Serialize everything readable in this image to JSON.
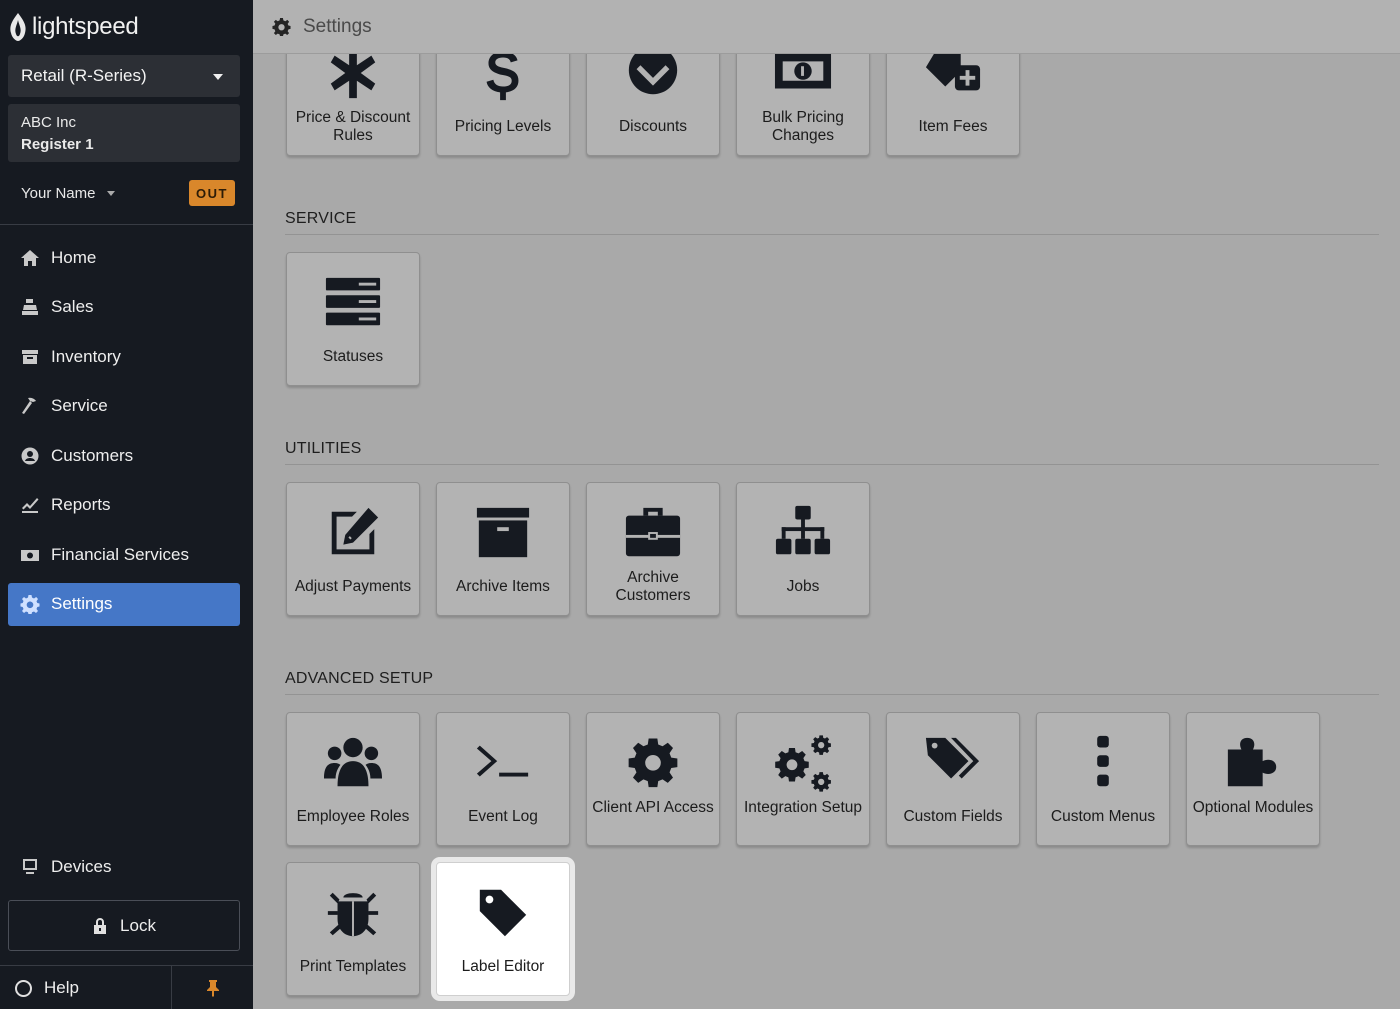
{
  "brand": {
    "name": "lightspeed"
  },
  "sidebar": {
    "account_selector": "Retail (R-Series)",
    "shop_name": "ABC Inc",
    "register": "Register 1",
    "user_name": "Your Name",
    "out_badge": "OUT",
    "nav": [
      {
        "label": "Home",
        "icon": "home-icon"
      },
      {
        "label": "Sales",
        "icon": "register-icon"
      },
      {
        "label": "Inventory",
        "icon": "inventory-icon"
      },
      {
        "label": "Service",
        "icon": "hammer-icon"
      },
      {
        "label": "Customers",
        "icon": "customer-icon"
      },
      {
        "label": "Reports",
        "icon": "chart-icon"
      },
      {
        "label": "Financial Services",
        "icon": "money-icon"
      },
      {
        "label": "Settings",
        "icon": "gear-icon",
        "active": true
      }
    ],
    "devices": "Devices",
    "lock": "Lock",
    "help": "Help"
  },
  "header": {
    "title": "Settings"
  },
  "sections": {
    "pricing_tiles": [
      {
        "label": "Price & Discount Rules",
        "icon": "asterisk-icon"
      },
      {
        "label": "Pricing Levels",
        "icon": "dollar-icon"
      },
      {
        "label": "Discounts",
        "icon": "chevron-circle-icon"
      },
      {
        "label": "Bulk Pricing Changes",
        "icon": "money-bill-icon"
      },
      {
        "label": "Item Fees",
        "icon": "tag-plus-icon"
      }
    ],
    "service": {
      "title": "SERVICE",
      "tiles": [
        {
          "label": "Statuses",
          "icon": "server-icon"
        }
      ]
    },
    "utilities": {
      "title": "UTILITIES",
      "tiles": [
        {
          "label": "Adjust Payments",
          "icon": "edit-icon"
        },
        {
          "label": "Archive Items",
          "icon": "archive-icon"
        },
        {
          "label": "Archive Customers",
          "icon": "briefcase-icon"
        },
        {
          "label": "Jobs",
          "icon": "sitemap-icon"
        }
      ]
    },
    "advanced": {
      "title": "ADVANCED SETUP",
      "tiles": [
        {
          "label": "Employee Roles",
          "icon": "users-icon"
        },
        {
          "label": "Event Log",
          "icon": "terminal-icon"
        },
        {
          "label": "Client API Access",
          "icon": "gear-icon"
        },
        {
          "label": "Integration Setup",
          "icon": "gears-icon"
        },
        {
          "label": "Custom Fields",
          "icon": "tags-icon"
        },
        {
          "label": "Custom Menus",
          "icon": "ellipsis-vertical-icon"
        },
        {
          "label": "Optional Modules",
          "icon": "puzzle-icon"
        },
        {
          "label": "Print Templates",
          "icon": "bug-icon"
        },
        {
          "label": "Label Editor",
          "icon": "tag-icon",
          "highlighted": true
        }
      ]
    }
  },
  "colors": {
    "sidebar_bg": "#161a21",
    "active_nav": "#4577c7",
    "out_badge": "#d9872b",
    "content_bg": "#a9a9a9"
  }
}
